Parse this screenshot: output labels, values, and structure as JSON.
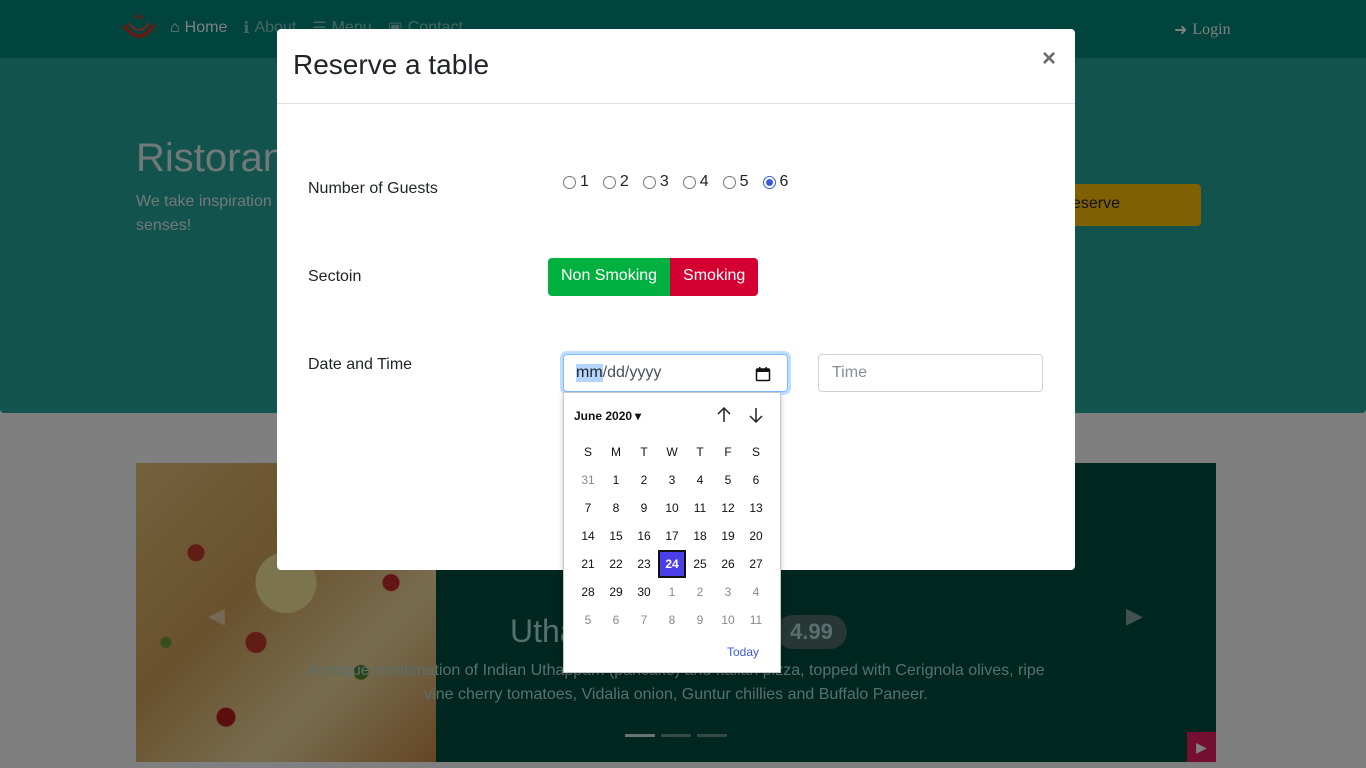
{
  "navbar": {
    "items": [
      {
        "label": "Home",
        "icon": "home-icon"
      },
      {
        "label": "About",
        "icon": "info-icon"
      },
      {
        "label": "Menu",
        "icon": "list-icon"
      },
      {
        "label": "Contact",
        "icon": "address-card-icon"
      }
    ],
    "login_label": "Login"
  },
  "jumbotron": {
    "title": "Ristoran",
    "text": "We take inspiration fusion experience. O senses!",
    "reserve_label": "eserve"
  },
  "carousel": {
    "title": "Utha",
    "price": "4.99",
    "caption": "A unique combination of Indian Uthappam (pancake) and Italian pizza, topped with Cerignola olives, ripe vine cherry tomatoes, Vidalia onion, Guntur chillies and Buffalo Paneer."
  },
  "modal": {
    "title": "Reserve a table",
    "close_label": "×",
    "guests_label": "Number of Guests",
    "guest_options": [
      "1",
      "2",
      "3",
      "4",
      "5",
      "6"
    ],
    "guest_selected": "6",
    "section_label": "Sectoin",
    "non_smoking_label": "Non Smoking",
    "smoking_label": "Smoking",
    "datetime_label": "Date and Time",
    "date_selected_part": "mm",
    "date_rest": "/dd/yyyy",
    "time_placeholder": "Time"
  },
  "datepicker": {
    "month_label": "June 2020",
    "weekdays": [
      "S",
      "M",
      "T",
      "W",
      "T",
      "F",
      "S"
    ],
    "weeks": [
      [
        "31",
        "1",
        "2",
        "3",
        "4",
        "5",
        "6"
      ],
      [
        "7",
        "8",
        "9",
        "10",
        "11",
        "12",
        "13"
      ],
      [
        "14",
        "15",
        "16",
        "17",
        "18",
        "19",
        "20"
      ],
      [
        "21",
        "22",
        "23",
        "24",
        "25",
        "26",
        "27"
      ],
      [
        "28",
        "29",
        "30",
        "1",
        "2",
        "3",
        "4"
      ],
      [
        "5",
        "6",
        "7",
        "8",
        "9",
        "10",
        "11"
      ]
    ],
    "selected_day": "24",
    "today_label": "Today",
    "colors": {
      "selected": "#4a3fe8",
      "link": "#3b5bdb"
    }
  },
  "colors": {
    "navbar": "#00897b",
    "jumbotron": "#26a69a",
    "non_smoking": "#00b140",
    "smoking": "#d50032",
    "reserve": "#ffc107"
  }
}
